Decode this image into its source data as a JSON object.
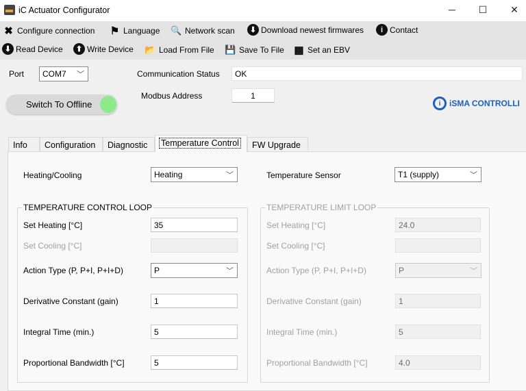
{
  "window": {
    "title": "iC Actuator Configurator",
    "minimize": "─",
    "maximize": "☐",
    "close": "✕"
  },
  "toolbar": {
    "row1": [
      {
        "label": "Configure connection",
        "icon": "wrench-screwdriver-icon",
        "glyph": "✖"
      },
      {
        "label": "Language",
        "icon": "flag-icon",
        "glyph": "⚑"
      },
      {
        "label": "Network scan",
        "icon": "search-icon",
        "glyph": "🔍"
      },
      {
        "label": "Download newest firmwares",
        "icon": "download-circle-icon",
        "glyph": "⬇"
      },
      {
        "label": "Contact",
        "icon": "info-icon",
        "glyph": "i"
      }
    ],
    "row2": [
      {
        "label": "Read Device",
        "icon": "download-circle-icon",
        "glyph": "⬇"
      },
      {
        "label": "Write Device",
        "icon": "upload-circle-icon",
        "glyph": "⬆"
      },
      {
        "label": "Load From File",
        "icon": "folder-icon",
        "glyph": "📂"
      },
      {
        "label": "Save To File",
        "icon": "save-icon",
        "glyph": "💾"
      },
      {
        "label": "Set an EBV",
        "icon": "ebv-device-icon",
        "glyph": "▦"
      }
    ]
  },
  "connection": {
    "port_label": "Port",
    "port_value": "COM7",
    "status_label": "Communication Status",
    "status_value": "OK",
    "modbus_label": "Modbus Address",
    "modbus_value": "1",
    "switch_label": "Switch To Offline",
    "led_color": "#8ee98a"
  },
  "logo": {
    "text": "iSMA CONTROLLI",
    "mark": "i"
  },
  "tabs": [
    "Info",
    "Configuration",
    "Diagnostic",
    "Temperature Control",
    "FW Upgrade"
  ],
  "active_tab": "Temperature Control",
  "temp": {
    "heating_cooling_label": "Heating/Cooling",
    "heating_cooling_value": "Heating",
    "sensor_label": "Temperature Sensor",
    "sensor_value": "T1 (supply)",
    "control_loop": {
      "title": "TEMPERATURE CONTROL LOOP",
      "rows": [
        {
          "label": "Set Heating [°C]",
          "value": "35"
        },
        {
          "label": "Set Cooling [°C]",
          "value": ""
        },
        {
          "label": "Action Type (P, P+I, P+I+D)",
          "value": "P"
        },
        {
          "label": "Derivative Constant (gain)",
          "value": "1"
        },
        {
          "label": "Integral Time (min.)",
          "value": "5"
        },
        {
          "label": "Proportional Bandwidth [°C]",
          "value": "5"
        }
      ]
    },
    "limit_loop": {
      "title": "TEMPERATURE LIMIT LOOP",
      "rows": [
        {
          "label": "Set Heating [°C]",
          "value": "24.0"
        },
        {
          "label": "Set Cooling [°C]",
          "value": ""
        },
        {
          "label": "Action Type (P, P+I, P+I+D)",
          "value": "P"
        },
        {
          "label": "Derivative Constant (gain)",
          "value": "1"
        },
        {
          "label": "Integral Time (min.)",
          "value": "5"
        },
        {
          "label": "Proportional Bandwidth [°C]",
          "value": "4.0"
        }
      ]
    }
  },
  "chevron": "﹀"
}
